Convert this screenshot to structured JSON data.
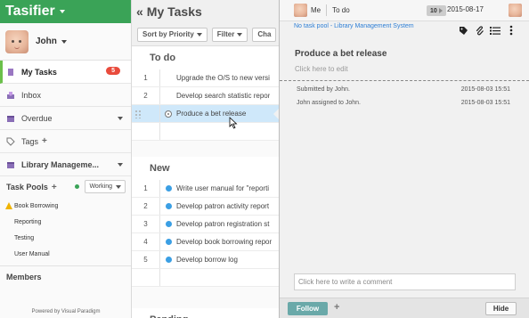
{
  "app": {
    "title": "Tasifier",
    "title_color": "#3aa357"
  },
  "user": {
    "name": "John"
  },
  "sidebar": {
    "nav": [
      {
        "label": "My Tasks",
        "badge": "5",
        "icon": "my-tasks-icon"
      },
      {
        "label": "Inbox",
        "icon": "inbox-icon"
      },
      {
        "label": "Overdue",
        "icon": "overdue-icon"
      },
      {
        "label": "Tags",
        "icon": "tag-icon"
      },
      {
        "label": "Library Manageme...",
        "icon": "project-icon"
      }
    ],
    "pools_header": "Task Pools",
    "pool_status": "Working",
    "pools": [
      "Book Borrowing",
      "Reporting",
      "Testing",
      "User Manual"
    ],
    "members": "Members",
    "powered_by": "Powered by Visual Paradigm"
  },
  "main": {
    "title": "My Tasks",
    "toolbar": {
      "sort": "Sort by Priority",
      "filter": "Filter",
      "third": "Cha"
    },
    "sections": {
      "todo": {
        "title": "To do",
        "rows": [
          {
            "num": "1",
            "text": "Upgrade the O/S to new versi"
          },
          {
            "num": "2",
            "text": "Develop search statistic repor"
          },
          {
            "num": "",
            "text": "Produce a bet release"
          }
        ]
      },
      "new": {
        "title": "New",
        "rows": [
          {
            "num": "1",
            "text": "Write user manual for \"reporti"
          },
          {
            "num": "2",
            "text": "Develop patron activity report"
          },
          {
            "num": "3",
            "text": "Develop patron registration st"
          },
          {
            "num": "4",
            "text": "Develop book borrowing repor"
          },
          {
            "num": "5",
            "text": "Develop borrow log"
          }
        ]
      },
      "pending": {
        "title": "Pending"
      }
    }
  },
  "detail": {
    "assignee": "Me",
    "status": "To do",
    "priority": "10",
    "due_date": "2015-08-17",
    "pool_link": "No task pool - Library Management System",
    "task_title": "Produce a bet release",
    "edit_hint": "Click here to edit",
    "log": [
      {
        "text": "Submitted by John.",
        "date": "2015-08-03 15:51"
      },
      {
        "text": "John assigned to John.",
        "date": "2015-08-03 15:51"
      }
    ],
    "comment_placeholder": "Click here to write a comment",
    "follow": "Follow",
    "hide": "Hide"
  }
}
